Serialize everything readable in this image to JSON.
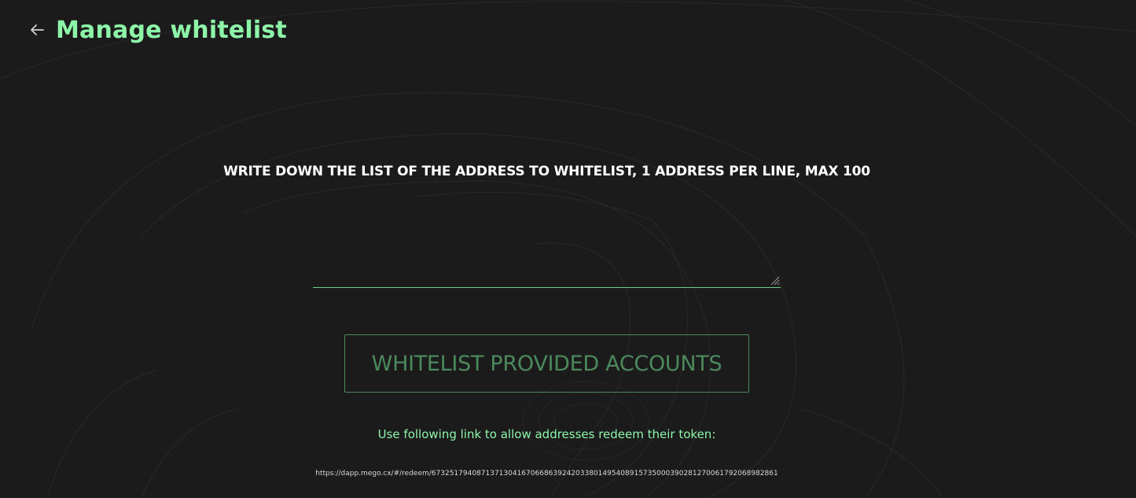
{
  "colors": {
    "background": "#1c1b1c",
    "accent": "#8df5a8",
    "button_border": "#4a8a5c",
    "text": "#ffffff"
  },
  "header": {
    "back_icon": "arrow-left-icon",
    "title": "Manage whitelist"
  },
  "form": {
    "instruction": "WRITE DOWN THE LIST OF THE ADDRESS TO WHITELIST, 1 ADDRESS PER LINE, MAX 100",
    "textarea_value": "",
    "submit_label": "WHITELIST PROVIDED ACCOUNTS"
  },
  "footer": {
    "link_note": "Use following link to allow addresses redeem their token:",
    "redeem_url": "https://dapp.mego.cx/#/redeem/6732517940871371304167066863924203380149540891573500039028127006179206898286​1"
  }
}
